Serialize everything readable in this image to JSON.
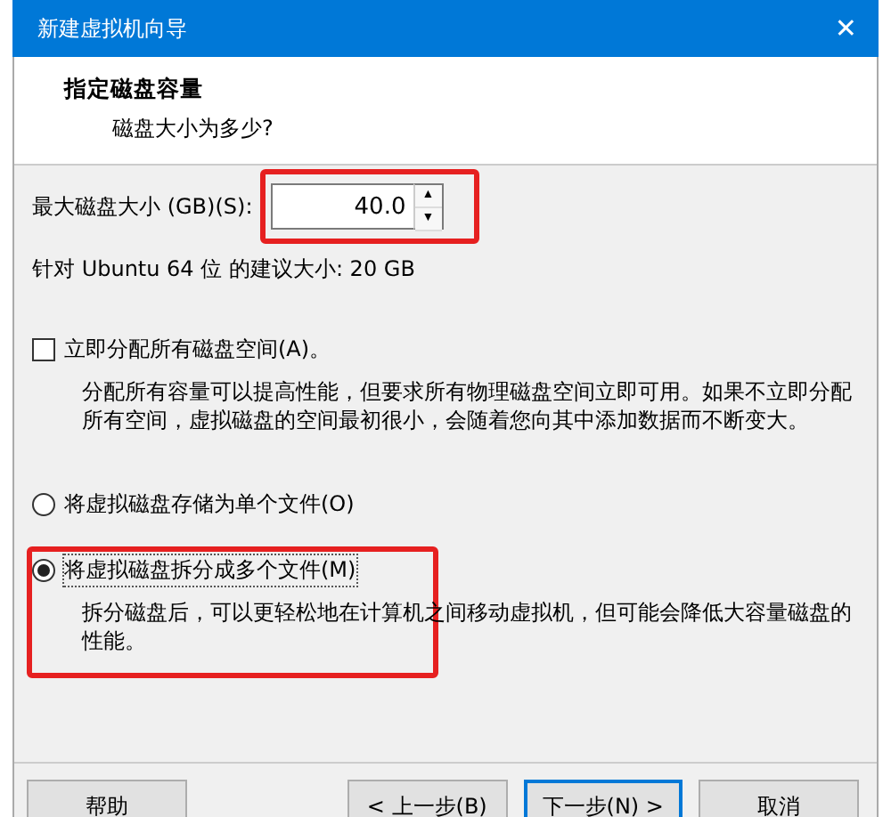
{
  "window": {
    "title": "新建虚拟机向导",
    "close": "✕"
  },
  "header": {
    "title": "指定磁盘容量",
    "subtitle": "磁盘大小为多少?"
  },
  "size": {
    "label": "最大磁盘大小 (GB)(S):",
    "value": "40.0",
    "highlighted": true,
    "up": "▲",
    "down": "▼"
  },
  "recommendation": "针对 Ubuntu 64 位 的建议大小: 20 GB",
  "allocate": {
    "label": "立即分配所有磁盘空间(A)。",
    "checked": false,
    "description": "分配所有容量可以提高性能，但要求所有物理磁盘空间立即可用。如果不立即分配所有空间，虚拟磁盘的空间最初很小，会随着您向其中添加数据而不断变大。"
  },
  "storage_options": [
    {
      "label": "将虚拟磁盘存储为单个文件(O)",
      "selected": false,
      "highlighted": false
    },
    {
      "label": "将虚拟磁盘拆分成多个文件(M)",
      "selected": true,
      "highlighted": true,
      "description": "拆分磁盘后，可以更轻松地在计算机之间移动虚拟机，但可能会降低大容量磁盘的性能。"
    }
  ],
  "buttons": [
    {
      "label": "帮助",
      "kind": "help",
      "default": false
    },
    {
      "label": "< 上一步(B)",
      "kind": "nav",
      "default": false
    },
    {
      "label": "下一步(N) >",
      "kind": "nav",
      "default": true
    },
    {
      "label": "取消",
      "kind": "cancel",
      "default": false
    }
  ]
}
